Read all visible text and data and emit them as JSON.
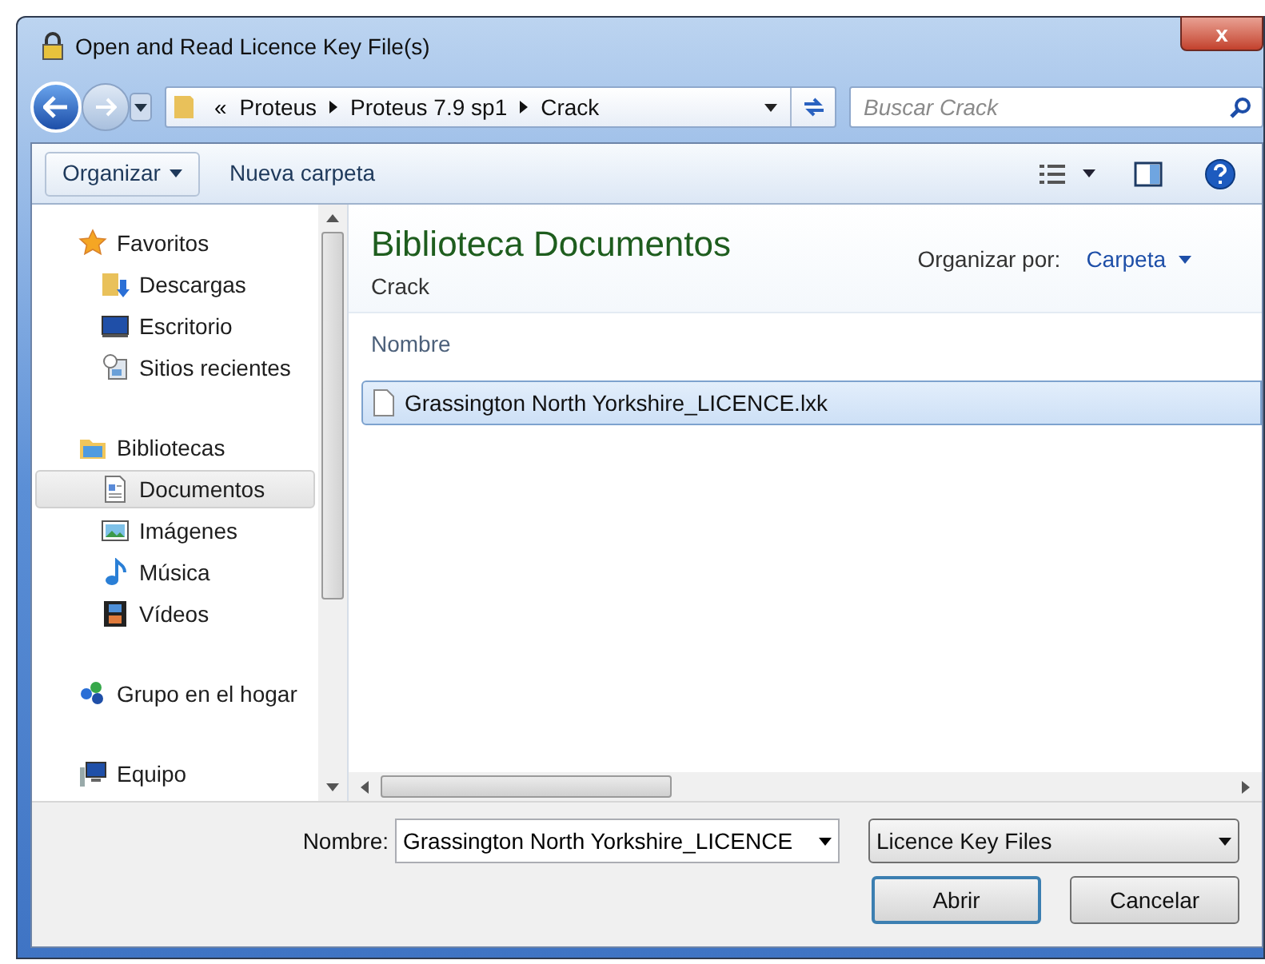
{
  "window": {
    "title": "Open and Read Licence Key File(s)",
    "close": "x"
  },
  "address_bar": {
    "prefix": "«",
    "crumbs": [
      "Proteus",
      "Proteus 7.9 sp1",
      "Crack"
    ]
  },
  "search": {
    "placeholder": "Buscar Crack"
  },
  "toolbar": {
    "organize": "Organizar",
    "new_folder": "Nueva carpeta"
  },
  "sidebar": {
    "items": [
      {
        "label": "Favoritos",
        "kind": "star",
        "selected": false,
        "children": [
          {
            "label": "Descargas",
            "kind": "download",
            "selected": false
          },
          {
            "label": "Escritorio",
            "kind": "desktop",
            "selected": false
          },
          {
            "label": "Sitios recientes",
            "kind": "recent",
            "selected": false
          }
        ]
      },
      {
        "label": "Bibliotecas",
        "kind": "library",
        "selected": false,
        "children": [
          {
            "label": "Documentos",
            "kind": "document",
            "selected": true
          },
          {
            "label": "Imágenes",
            "kind": "image",
            "selected": false
          },
          {
            "label": "Música",
            "kind": "music",
            "selected": false
          },
          {
            "label": "Vídeos",
            "kind": "video",
            "selected": false
          }
        ]
      },
      {
        "label": "Grupo en el hogar",
        "kind": "homegroup",
        "selected": false
      },
      {
        "label": "Equipo",
        "kind": "computer",
        "selected": false
      }
    ]
  },
  "library": {
    "title": "Biblioteca Documentos",
    "subtitle": "Crack",
    "arrange_label": "Organizar por:",
    "arrange_value": "Carpeta"
  },
  "file_list": {
    "column": "Nombre",
    "files": [
      {
        "name": "Grassington North Yorkshire_LICENCE.lxk",
        "selected": true
      }
    ]
  },
  "filename": {
    "label": "Nombre:",
    "value": "Grassington North Yorkshire_LICENCE"
  },
  "file_type": {
    "value": "Licence Key Files"
  },
  "buttons": [
    {
      "label": "Abrir",
      "default": true
    },
    {
      "label": "Cancelar",
      "default": false
    }
  ]
}
